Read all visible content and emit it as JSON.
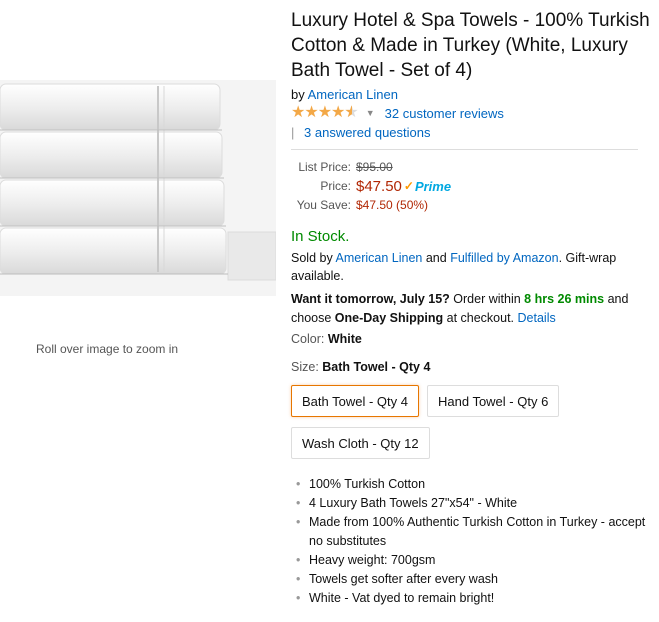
{
  "product": {
    "title": "Luxury Hotel & Spa Towels - 100% Turkish Cotton & Made in Turkey (White, Luxury Bath Towel - Set of 4)",
    "by_prefix": "by",
    "brand": "American Linen",
    "rating_stars": 4.5,
    "reviews_label": "32 customer reviews",
    "qa_label": "3 answered questions"
  },
  "image": {
    "zoom_hint": "Roll over image to zoom in"
  },
  "pricing": {
    "list_label": "List Price:",
    "list_value": "$95.00",
    "price_label": "Price:",
    "price_value": "$47.50",
    "prime_label": "Prime",
    "save_label": "You Save:",
    "save_value": "$47.50 (50%)"
  },
  "availability": {
    "stock": "In Stock.",
    "sold_prefix": "Sold by",
    "seller": "American Linen",
    "and": "and",
    "fulfilled": "Fulfilled by Amazon",
    "sold_suffix": ". Gift-wrap available."
  },
  "delivery": {
    "want_label": "Want it tomorrow, July 15?",
    "order_within": "Order within",
    "countdown": "8 hrs 26 mins",
    "choose": "and choose",
    "shipping": "One-Day Shipping",
    "at_checkout": "at checkout.",
    "details": "Details"
  },
  "color": {
    "label": "Color:",
    "value": "White"
  },
  "size": {
    "label": "Size:",
    "value": "Bath Towel - Qty 4",
    "options": [
      "Bath Towel - Qty 4",
      "Hand Towel - Qty 6",
      "Wash Cloth - Qty 12"
    ]
  },
  "features": [
    "100% Turkish Cotton",
    "4 Luxury Bath Towels 27\"x54\" - White",
    "Made from 100% Authentic Turkish Cotton in Turkey - accept no substitutes",
    "Heavy weight: 700gsm",
    "Towels get softer after every wash",
    "White - Vat dyed to remain bright!"
  ],
  "colors": {
    "link": "#0066c0",
    "price": "#b12704",
    "stock": "#008a00",
    "star": "#f3a847",
    "selected_border": "#e77600"
  }
}
